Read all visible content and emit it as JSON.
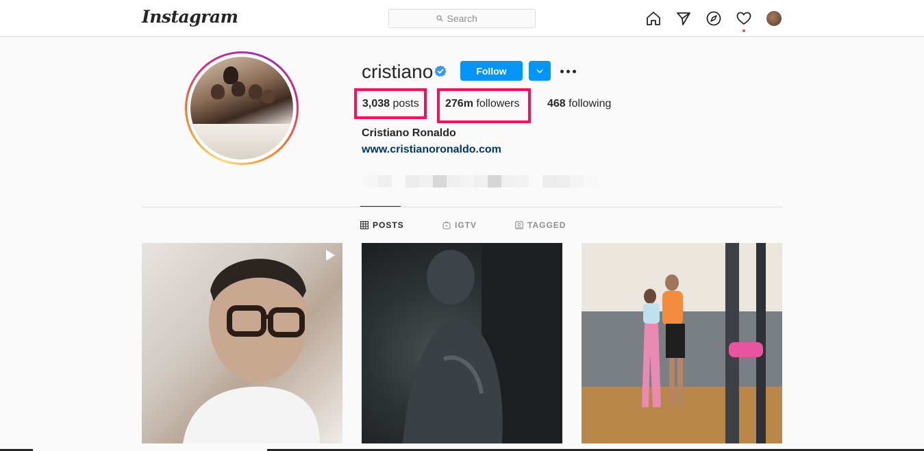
{
  "topbar": {
    "logo": "Instagram",
    "search_placeholder": "Search",
    "icons": [
      "home-icon",
      "direct-icon",
      "explore-icon",
      "activity-heart-icon",
      "profile-avatar"
    ]
  },
  "profile": {
    "username": "cristiano",
    "verified": true,
    "follow_label": "Follow",
    "posts_count": "3,038",
    "posts_label": " posts",
    "followers_count": "276m",
    "followers_label": " followers",
    "following_count": "468",
    "following_label": " following",
    "full_name": "Cristiano Ronaldo",
    "website": "www.cristianoronaldo.com"
  },
  "tabs": [
    {
      "label": "POSTS",
      "icon": "grid-icon",
      "active": true
    },
    {
      "label": "IGTV",
      "icon": "igtv-icon",
      "active": false
    },
    {
      "label": "TAGGED",
      "icon": "tagged-icon",
      "active": false
    }
  ],
  "posts": [
    {
      "kind": "video",
      "icon": "play-icon"
    },
    {
      "kind": "photo"
    },
    {
      "kind": "photo"
    }
  ],
  "colors": {
    "follow_button": "#0095f6",
    "highlight_box": "#f0145a",
    "link": "#00376b",
    "verified_badge": "#3897f0"
  }
}
